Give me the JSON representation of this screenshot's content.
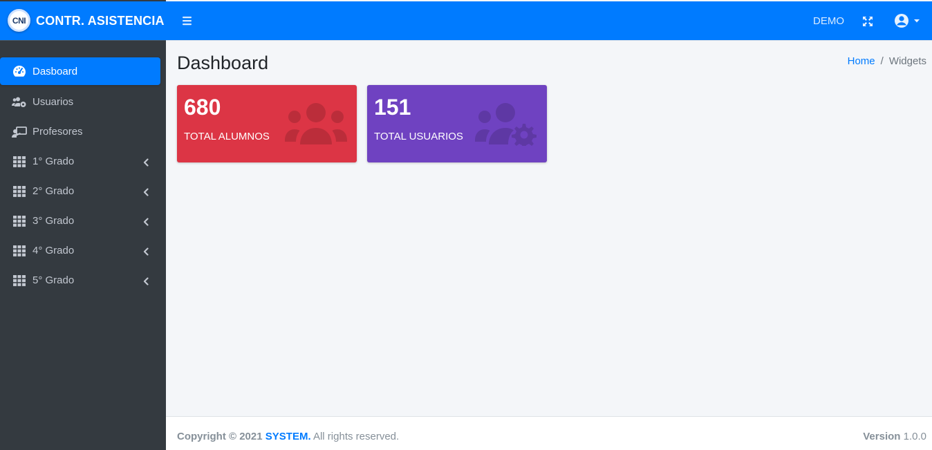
{
  "brand": {
    "logo_text": "CNI",
    "title": "CONTR. ASISTENCIA"
  },
  "sidebar": {
    "items": [
      {
        "label": "Dasboard",
        "icon": "tachometer-icon",
        "active": true
      },
      {
        "label": "Usuarios",
        "icon": "users-cog-icon"
      },
      {
        "label": "Profesores",
        "icon": "chalkboard-teacher-icon"
      },
      {
        "label": "1° Grado",
        "icon": "grid-icon",
        "has_children": true
      },
      {
        "label": "2° Grado",
        "icon": "grid-icon",
        "has_children": true
      },
      {
        "label": "3° Grado",
        "icon": "grid-icon",
        "has_children": true
      },
      {
        "label": "4° Grado",
        "icon": "grid-icon",
        "has_children": true
      },
      {
        "label": "5° Grado",
        "icon": "grid-icon",
        "has_children": true
      }
    ]
  },
  "topbar": {
    "demo_label": "DEMO"
  },
  "content": {
    "title": "Dashboard",
    "breadcrumb": {
      "home": "Home",
      "separator": "/",
      "current": "Widgets"
    },
    "widgets": [
      {
        "value": "680",
        "label": "TOTAL ALUMNOS",
        "color": "#dc3545",
        "icon": "users-icon"
      },
      {
        "value": "151",
        "label": "TOTAL USUARIOS",
        "color": "#6f42c1",
        "icon": "users-cog-icon"
      }
    ]
  },
  "footer": {
    "copyright": "Copyright © 2021",
    "system": "SYSTEM.",
    "rights": "All rights reserved.",
    "version_label": "Version",
    "version_value": "1.0.0"
  },
  "colors": {
    "primary": "#007bff",
    "sidebar": "#343a40",
    "danger": "#dc3545",
    "purple": "#6f42c1"
  }
}
